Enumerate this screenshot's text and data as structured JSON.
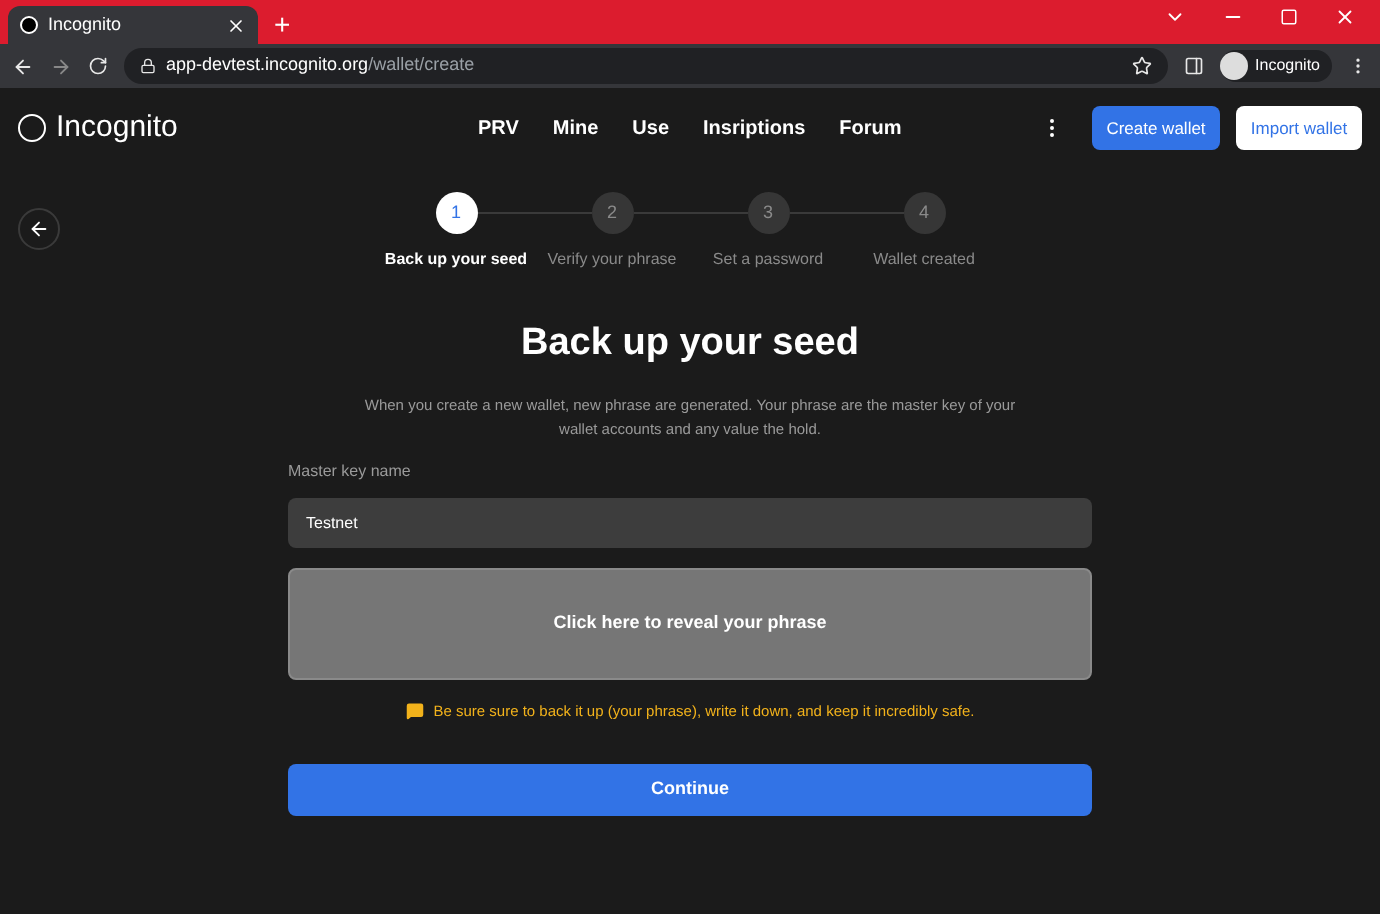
{
  "browser": {
    "tab_title": "Incognito",
    "new_tab": "+",
    "url_host": "app-devtest.incognito.org",
    "url_path": "/wallet/create",
    "profile": "Incognito"
  },
  "header": {
    "logo": "Incognito",
    "nav": [
      "PRV",
      "Mine",
      "Use",
      "Insriptions",
      "Forum"
    ],
    "create_button": "Create wallet",
    "import_button": "Import wallet"
  },
  "steps": [
    {
      "number": "1",
      "label": "Back up your seed",
      "selected": true
    },
    {
      "number": "2",
      "label": "Verify your phrase",
      "selected": false
    },
    {
      "number": "3",
      "label": "Set a password",
      "selected": false
    },
    {
      "number": "4",
      "label": "Wallet created",
      "selected": false
    }
  ],
  "title": "Back up your seed",
  "description": "When you create a new wallet, new phrase are generated. Your phrase are the master key of your wallet accounts and any value the hold.",
  "field": {
    "label": "Master key name",
    "value": "Testnet"
  },
  "reveal": "Click here to reveal your phrase",
  "warning": "Be sure sure to back it up (your phrase), write it down, and keep it incredibly safe.",
  "continue_button": "Continue"
}
